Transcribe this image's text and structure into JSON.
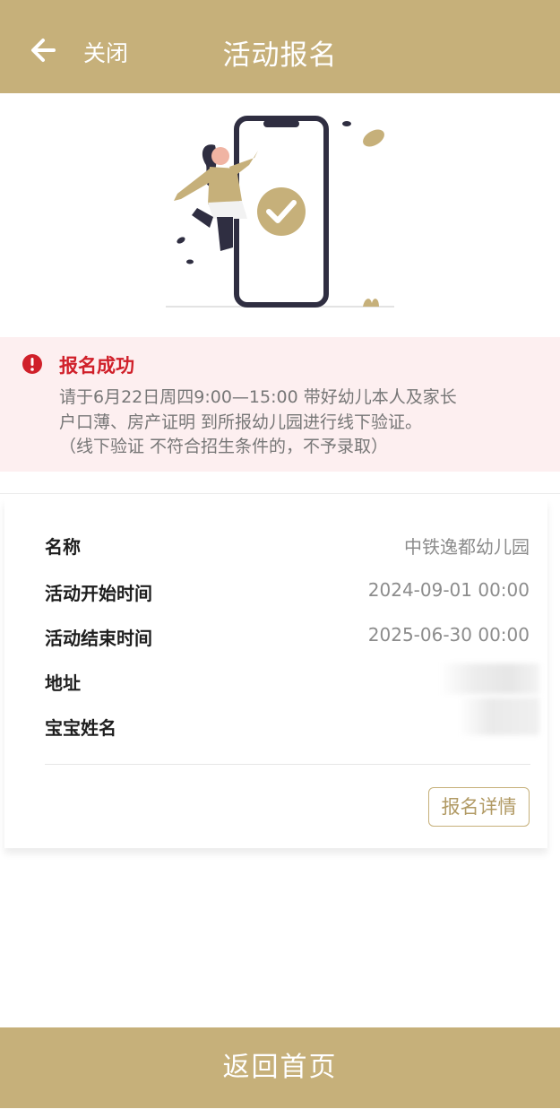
{
  "header": {
    "close_label": "关闭",
    "title": "活动报名"
  },
  "alert": {
    "title": "报名成功",
    "lines": [
      "请于6月22日周四9:00—15:00 带好幼儿本人及家长",
      "户口薄、房产证明 到所报幼儿园进行线下验证。",
      "（线下验证 不符合招生条件的，不予录取）"
    ]
  },
  "info": {
    "rows": [
      {
        "label": "名称",
        "value": "中铁逸都幼儿园"
      },
      {
        "label": "活动开始时间",
        "value": "2024-09-01 00:00"
      },
      {
        "label": "活动结束时间",
        "value": "2025-06-30 00:00"
      },
      {
        "label": "地址",
        "value": ""
      },
      {
        "label": "宝宝姓名",
        "value": ""
      }
    ],
    "detail_button": "报名详情"
  },
  "footer": {
    "home_button": "返回首页"
  },
  "colors": {
    "brand": "#c6b07a",
    "alert_bg": "#fdeff0",
    "alert_red": "#d0202a"
  },
  "icons": {
    "back": "arrow-left-icon",
    "alert": "exclamation-circle-icon",
    "check": "check-circle-icon"
  }
}
